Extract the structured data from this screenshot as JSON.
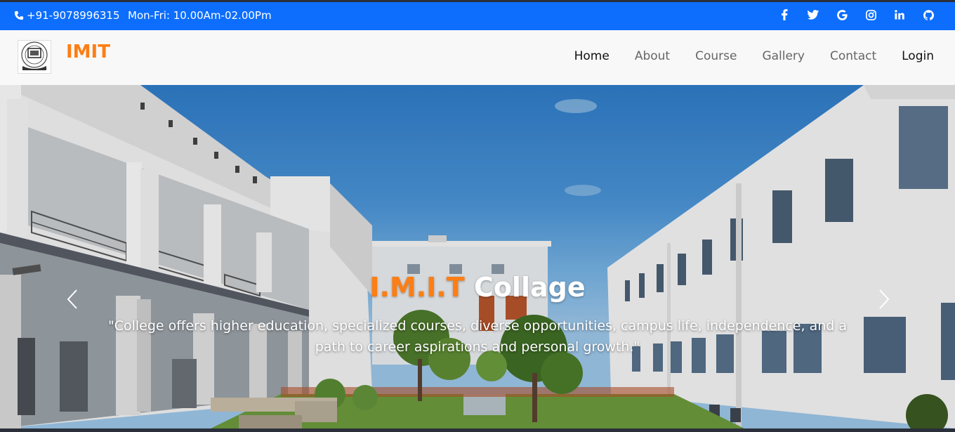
{
  "topbar": {
    "phone": "+91-9078996315",
    "hours": "Mon-Fri: 10.00Am-02.00Pm",
    "social_icons": [
      "facebook-icon",
      "twitter-icon",
      "google-icon",
      "instagram-icon",
      "linkedin-icon",
      "github-icon"
    ],
    "bg_color": "#0d6efd"
  },
  "navbar": {
    "brand": "IMIT",
    "brand_color": "#fd7e14",
    "items": [
      {
        "label": "Home"
      },
      {
        "label": "About"
      },
      {
        "label": "Course"
      },
      {
        "label": "Gallery"
      },
      {
        "label": "Contact"
      },
      {
        "label": "Login"
      }
    ]
  },
  "hero": {
    "title_accent": "I.M.I.T",
    "title_rest": "Collage",
    "subtitle": "\"College offers higher education, specialized courses, diverse opportunities, campus life, independence, and a path to career aspirations and personal growth.\""
  }
}
